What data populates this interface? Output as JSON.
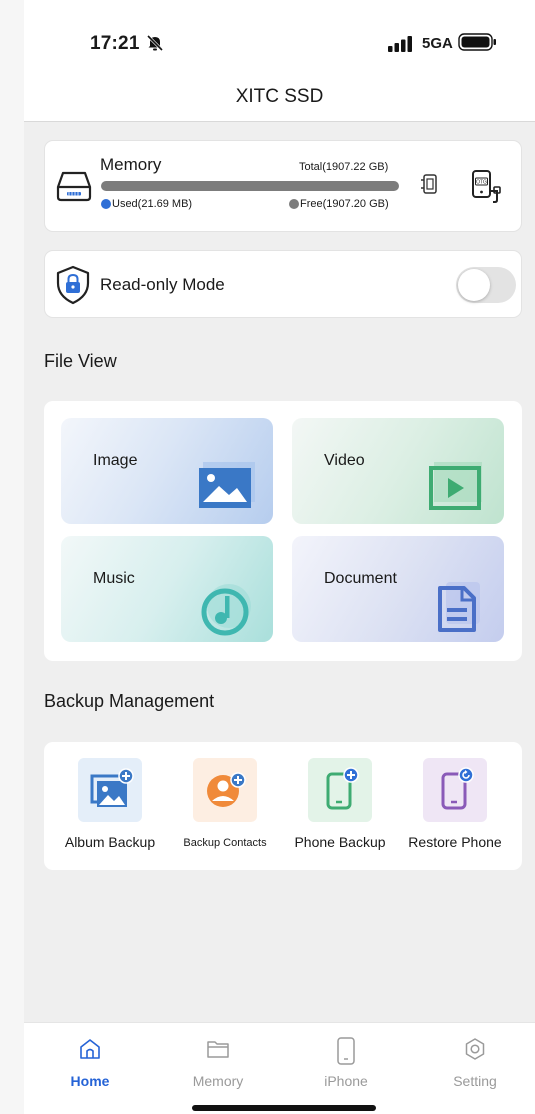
{
  "status_bar": {
    "time": "17:21",
    "network": "5GA",
    "icons": [
      "bell-slash-icon",
      "signal-icon",
      "battery-icon"
    ]
  },
  "header": {
    "title": "XITC SSD"
  },
  "memory": {
    "title": "Memory",
    "total": "Total(1907.22 GB)",
    "used": "Used(21.69 MB)",
    "free": "Free(1907.20 GB)",
    "used_fraction": 1.11e-05,
    "icons": [
      "hard-drive-icon",
      "usb-connector-icon",
      "otg-phone-icon"
    ]
  },
  "read_only": {
    "label": "Read-only Mode",
    "enabled": false,
    "icon": "shield-lock-icon"
  },
  "file_view": {
    "title": "File View",
    "tiles": [
      {
        "label": "Image",
        "icon": "image-icon",
        "color": "#3a78c6"
      },
      {
        "label": "Video",
        "icon": "video-icon",
        "color": "#3eab72"
      },
      {
        "label": "Music",
        "icon": "music-icon",
        "color": "#3fb7b0"
      },
      {
        "label": "Document",
        "icon": "document-icon",
        "color": "#4a6fc7"
      }
    ]
  },
  "backup": {
    "title": "Backup Management",
    "items": [
      {
        "label": "Album Backup",
        "icon": "album-backup-icon",
        "color": "#3a78c6"
      },
      {
        "label": "Backup Contacts",
        "icon": "contact-backup-icon",
        "color": "#f08a3a"
      },
      {
        "label": "Phone Backup",
        "icon": "phone-backup-icon",
        "color": "#3eab72"
      },
      {
        "label": "Restore Phone",
        "icon": "phone-restore-icon",
        "color": "#8a5ab8"
      }
    ]
  },
  "tab_bar": {
    "active": "Home",
    "tabs": [
      {
        "label": "Home",
        "icon": "home-icon"
      },
      {
        "label": "Memory",
        "icon": "folder-icon"
      },
      {
        "label": "iPhone",
        "icon": "iphone-icon"
      },
      {
        "label": "Setting",
        "icon": "settings-icon"
      }
    ]
  },
  "colors": {
    "accent": "#2563d6",
    "used_dot": "#2f6fd6",
    "free_dot": "#7c7c7c",
    "background": "#efefef"
  }
}
